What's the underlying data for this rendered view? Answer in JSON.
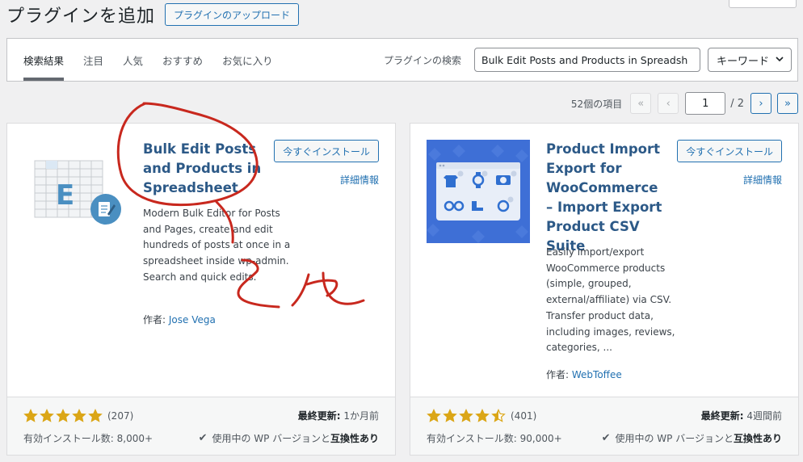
{
  "page": {
    "title": "プラグインを追加",
    "upload_button": "プラグインのアップロード"
  },
  "filters": {
    "tabs": [
      {
        "label": "検索結果",
        "active": true
      },
      {
        "label": "注目",
        "active": false
      },
      {
        "label": "人気",
        "active": false
      },
      {
        "label": "おすすめ",
        "active": false
      },
      {
        "label": "お気に入り",
        "active": false
      }
    ],
    "search_label": "プラグインの検索",
    "search_value": "Bulk Edit Posts and Products in Spreadsh",
    "search_type": "キーワード"
  },
  "pagination": {
    "item_count": "52個の項目",
    "first": "«",
    "prev": "‹",
    "current_page": "1",
    "total": "/ 2",
    "next": "›",
    "last": "»"
  },
  "plugins": [
    {
      "name": "Bulk Edit Posts and Products in Spreadsheet",
      "install_label": "今すぐインストール",
      "details_label": "詳細情報",
      "description": "Modern Bulk Editor for Posts and Pages, create and edit hundreds of posts at once in a spreadsheet inside wp-admin. Search and quick edits.",
      "author_prefix": "作者:",
      "author": "Jose Vega",
      "rating": 5,
      "rating_count": "(207)",
      "installs": "有効インストール数: 8,000+",
      "updated_label": "最終更新:",
      "updated_value": "1か月前",
      "compat_text": "使用中の WP バージョンと",
      "compat_bold": "互換性あり",
      "icon": "spreadsheet-edit-icon",
      "accent_color": "#4a8fc1"
    },
    {
      "name": "Product Import Export for WooCommerce – Import Export Product CSV Suite",
      "install_label": "今すぐインストール",
      "details_label": "詳細情報",
      "description": "Easily import/export WooCommerce products (simple, grouped, external/affiliate) via CSV. Transfer product data, including images, reviews, categories, ...",
      "author_prefix": "作者:",
      "author": "WebToffee",
      "rating": 4.5,
      "rating_count": "(401)",
      "installs": "有効インストール数: 90,000+",
      "updated_label": "最終更新:",
      "updated_value": "4週間前",
      "compat_text": "使用中の WP バージョンと",
      "compat_bold": "互換性あり",
      "icon": "product-import-icon",
      "accent_color": "#3e6fd6"
    }
  ],
  "annotation": {
    "color": "#c8281e"
  }
}
